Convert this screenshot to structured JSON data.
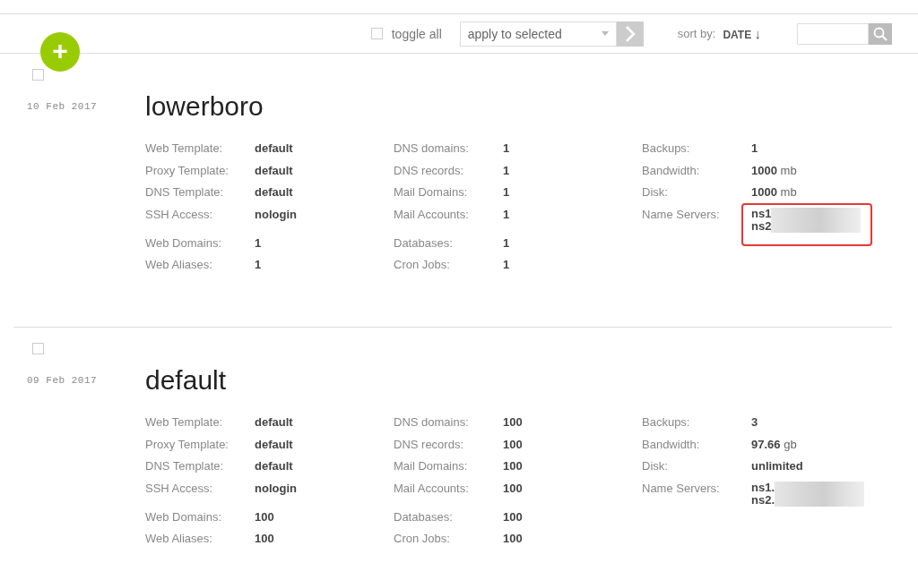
{
  "toolbar": {
    "toggle_all": {
      "label": "toggle all",
      "checked": false
    },
    "action_select": {
      "value": "apply to selected"
    },
    "sort": {
      "label": "sort by:",
      "value": "DATE",
      "arrow": "↓"
    }
  },
  "add_button": {
    "label": "+"
  },
  "packages": [
    {
      "checked": false,
      "date": "10 Feb 2017",
      "name": "lowerboro",
      "highlighted": true,
      "columns": [
        {
          "groups": [
            [
              {
                "label": "Web Template:",
                "value": "default"
              },
              {
                "label": "Proxy Template:",
                "value": "default"
              },
              {
                "label": "DNS Template:",
                "value": "default"
              },
              {
                "label": "SSH Access:",
                "value": "nologin"
              }
            ],
            [
              {
                "label": "Web Domains:",
                "value": "1"
              },
              {
                "label": "Web Aliases:",
                "value": "1"
              }
            ]
          ]
        },
        {
          "groups": [
            [
              {
                "label": "DNS domains:",
                "value": "1"
              },
              {
                "label": "DNS records:",
                "value": "1"
              },
              {
                "label": "Mail Domains:",
                "value": "1"
              },
              {
                "label": "Mail Accounts:",
                "value": "1"
              }
            ],
            [
              {
                "label": "Databases:",
                "value": "1"
              },
              {
                "label": "Cron Jobs:",
                "value": "1"
              }
            ]
          ]
        }
      ],
      "stats": [
        {
          "label": "Backups:",
          "value": "1"
        },
        {
          "label": "Bandwidth:",
          "value": "1000",
          "unit": "mb"
        },
        {
          "label": "Disk:",
          "value": "1000",
          "unit": "mb"
        }
      ],
      "name_servers": {
        "label": "Name Servers:",
        "values": [
          "ns1",
          "ns2"
        ]
      }
    },
    {
      "checked": false,
      "date": "09 Feb 2017",
      "name": "default",
      "highlighted": false,
      "columns": [
        {
          "groups": [
            [
              {
                "label": "Web Template:",
                "value": "default"
              },
              {
                "label": "Proxy Template:",
                "value": "default"
              },
              {
                "label": "DNS Template:",
                "value": "default"
              },
              {
                "label": "SSH Access:",
                "value": "nologin"
              }
            ],
            [
              {
                "label": "Web Domains:",
                "value": "100"
              },
              {
                "label": "Web Aliases:",
                "value": "100"
              }
            ]
          ]
        },
        {
          "groups": [
            [
              {
                "label": "DNS domains:",
                "value": "100"
              },
              {
                "label": "DNS records:",
                "value": "100"
              },
              {
                "label": "Mail Domains:",
                "value": "100"
              },
              {
                "label": "Mail Accounts:",
                "value": "100"
              }
            ],
            [
              {
                "label": "Databases:",
                "value": "100"
              },
              {
                "label": "Cron Jobs:",
                "value": "100"
              }
            ]
          ]
        }
      ],
      "stats": [
        {
          "label": "Backups:",
          "value": "3"
        },
        {
          "label": "Bandwidth:",
          "value": "97.66",
          "unit": "gb"
        },
        {
          "label": "Disk:",
          "value": "unlimited"
        }
      ],
      "name_servers": {
        "label": "Name Servers:",
        "values": [
          "ns1.",
          "ns2."
        ]
      }
    }
  ]
}
